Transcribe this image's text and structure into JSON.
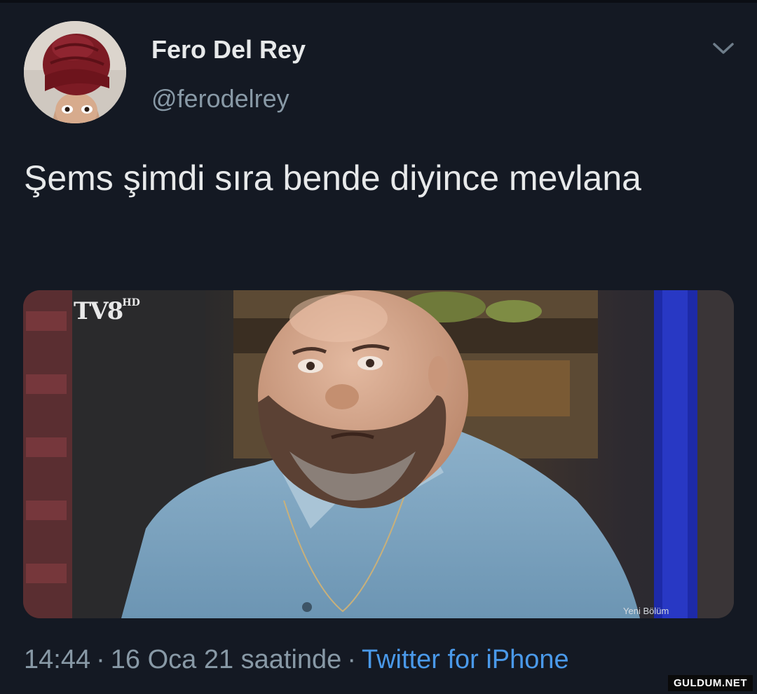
{
  "user": {
    "display_name": "Fero Del Rey",
    "handle": "@ferodelrey",
    "avatar_icon": "avatar-turban-icon"
  },
  "tweet": {
    "text": "Şems şimdi sıra bende diyince mevlana"
  },
  "media": {
    "channel_logo": "TV8",
    "channel_logo_suffix": "HD",
    "caption": "Yeni Bölüm"
  },
  "meta": {
    "time": "14:44",
    "date": "16 Oca 21 saatinde",
    "source": "Twitter for iPhone",
    "separator": "·"
  },
  "watermark": "GULDUM.NET",
  "colors": {
    "background": "#141923",
    "text_primary": "#e7e9ea",
    "text_secondary": "#8899a6",
    "link": "#4a99e9"
  }
}
